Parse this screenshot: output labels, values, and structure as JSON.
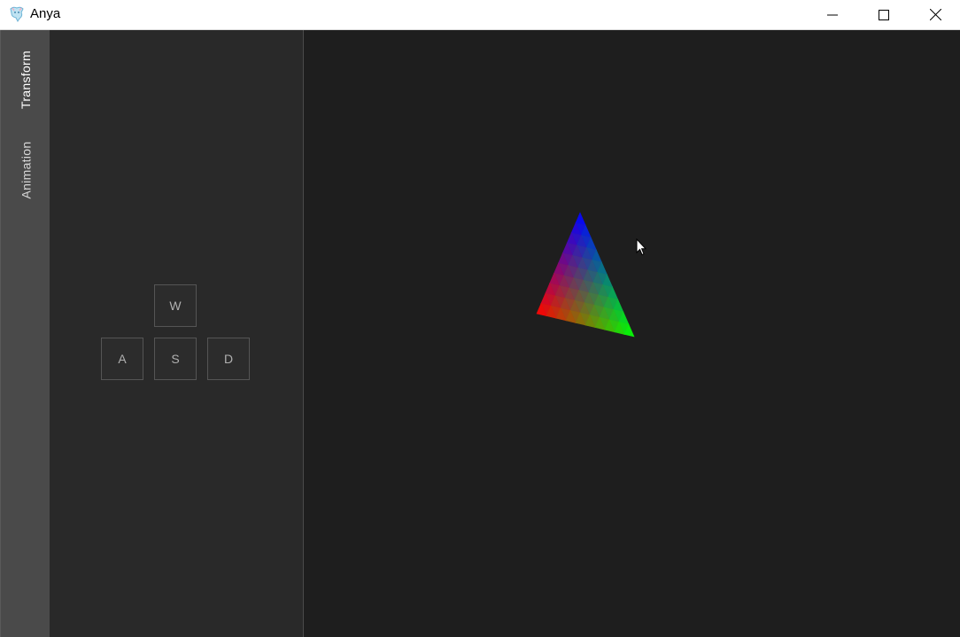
{
  "window": {
    "title": "Anya",
    "app_icon": "anya-app-icon",
    "controls": {
      "minimize_icon": "minimize-icon",
      "maximize_icon": "maximize-icon",
      "close_icon": "close-icon"
    }
  },
  "tabs": [
    {
      "label": "Transform",
      "active": true
    },
    {
      "label": "Animation",
      "active": false
    }
  ],
  "keys": {
    "w": "W",
    "a": "A",
    "s": "S",
    "d": "D"
  },
  "viewport": {
    "triangle_colors": {
      "top": "#0000ff",
      "left": "#ff0000",
      "right": "#00ff00"
    }
  },
  "colors": {
    "background": "#1e1e1e",
    "panel": "#292929",
    "tab_strip": "#4a4a4a",
    "titlebar": "#ffffff"
  }
}
